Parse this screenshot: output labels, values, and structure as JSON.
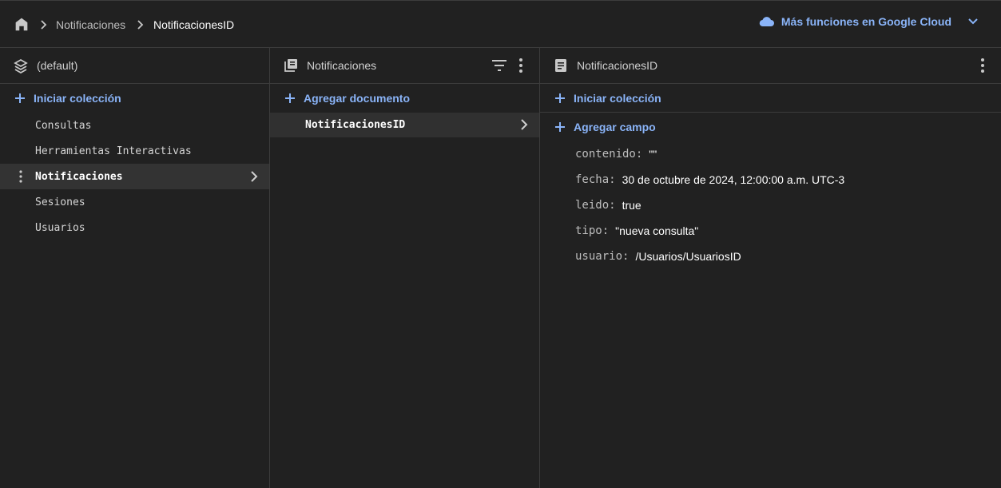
{
  "breadcrumb": {
    "items": [
      "Notificaciones",
      "NotificacionesID"
    ]
  },
  "header": {
    "gcloud_label": "Más funciones en Google Cloud"
  },
  "panel_database": {
    "title": "(default)",
    "action_label": "Iniciar colección",
    "collections": [
      "Consultas",
      "Herramientas Interactivas",
      "Notificaciones",
      "Sesiones",
      "Usuarios"
    ],
    "selected_collection": "Notificaciones"
  },
  "panel_collection": {
    "title": "Notificaciones",
    "action_label": "Agregar documento",
    "documents": [
      "NotificacionesID"
    ]
  },
  "panel_document": {
    "title": "NotificacionesID",
    "start_collection_label": "Iniciar colección",
    "add_field_label": "Agregar campo",
    "fields": [
      {
        "key": "contenido:",
        "value": "\"\""
      },
      {
        "key": "fecha:",
        "value": "30 de octubre de 2024, 12:00:00 a.m. UTC-3"
      },
      {
        "key": "leido:",
        "value": "true"
      },
      {
        "key": "tipo:",
        "value": "\"nueva consulta\""
      },
      {
        "key": "usuario:",
        "value": "/Usuarios/UsuariosID"
      }
    ]
  },
  "colors": {
    "background": "#212121",
    "accent": "#8ab4f8",
    "border": "#3c3c3c"
  }
}
